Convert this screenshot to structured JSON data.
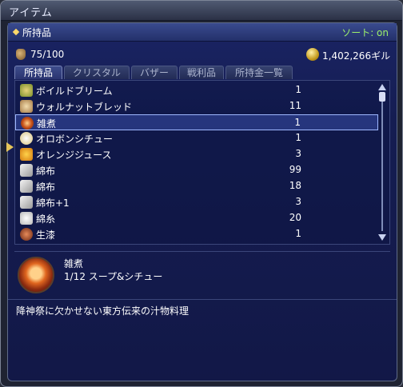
{
  "window": {
    "title": "アイテム"
  },
  "header": {
    "label": "所持品",
    "sort": "ソート: on"
  },
  "inventory": {
    "count": "75/100",
    "gil": "1,402,266ギル"
  },
  "tabs": [
    {
      "label": "所持品",
      "active": true
    },
    {
      "label": "クリスタル",
      "active": false
    },
    {
      "label": "バザー",
      "active": false
    },
    {
      "label": "戦利品",
      "active": false
    },
    {
      "label": "所持金一覧",
      "active": false
    }
  ],
  "items": [
    {
      "name": "ボイルドブリーム",
      "qty": "1",
      "icon": "fish-icon"
    },
    {
      "name": "ウォルナットブレッド",
      "qty": "11",
      "icon": "bread-icon"
    },
    {
      "name": "雑煮",
      "qty": "1",
      "icon": "soup-bowl-icon",
      "selected": true
    },
    {
      "name": "オロボンシチュー",
      "qty": "1",
      "icon": "stew-icon"
    },
    {
      "name": "オレンジジュース",
      "qty": "3",
      "icon": "juice-icon"
    },
    {
      "name": "綿布",
      "qty": "99",
      "icon": "cloth-icon"
    },
    {
      "name": "綿布",
      "qty": "18",
      "icon": "cloth-icon"
    },
    {
      "name": "綿布+1",
      "qty": "3",
      "icon": "cloth-icon"
    },
    {
      "name": "綿糸",
      "qty": "20",
      "icon": "thread-icon"
    },
    {
      "name": "生漆",
      "qty": "1",
      "icon": "lacquer-icon"
    }
  ],
  "detail": {
    "name": "雑煮",
    "stack": "1/12 スープ&シチュー",
    "description": "降神祭に欠かせない東方伝来の汁物料理"
  },
  "colors": {
    "sort_on": "#9cf06a",
    "panel_bg": "#1a2464",
    "selection": "#9fb8ff"
  }
}
